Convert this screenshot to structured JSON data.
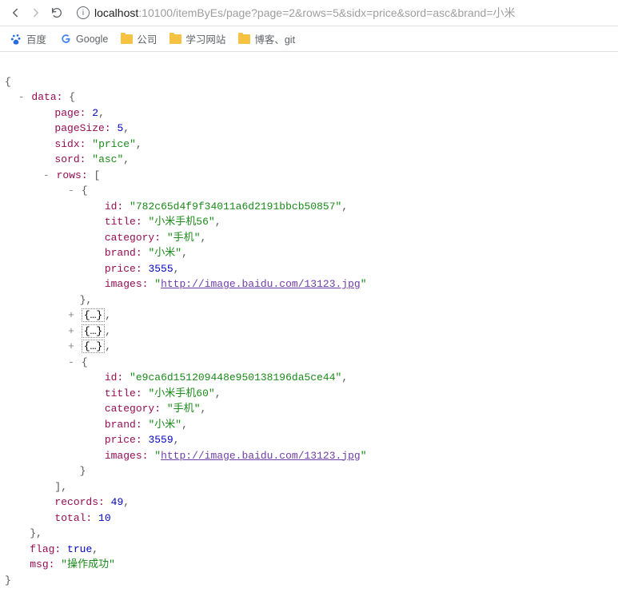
{
  "browser": {
    "url_host": "localhost",
    "url_path": ":10100/itemByEs/page?page=2&rows=5&sidx=price&sord=asc&brand=小米"
  },
  "bookmarks": [
    {
      "name": "百度",
      "kind": "baidu"
    },
    {
      "name": "Google",
      "kind": "google"
    },
    {
      "name": "公司",
      "kind": "folder"
    },
    {
      "name": "学习网站",
      "kind": "folder"
    },
    {
      "name": "博客、git",
      "kind": "folder"
    }
  ],
  "json": {
    "data": {
      "page": 2,
      "pageSize": 5,
      "sidx": "price",
      "sord": "asc",
      "rows_expanded_0": {
        "id": "782c65d4f9f34011a6d2191bbcb50857",
        "title": "小米手机56",
        "category": "手机",
        "brand": "小米",
        "price": 3555,
        "images": "http://image.baidu.com/13123.jpg"
      },
      "rows_collapsed_count": 3,
      "rows_expanded_4": {
        "id": "e9ca6d151209448e950138196da5ce44",
        "title": "小米手机60",
        "category": "手机",
        "brand": "小米",
        "price": 3559,
        "images": "http://image.baidu.com/13123.jpg"
      },
      "records": 49,
      "total": 10
    },
    "flag": true,
    "msg": "操作成功",
    "collapsed_placeholder": "{…}"
  }
}
